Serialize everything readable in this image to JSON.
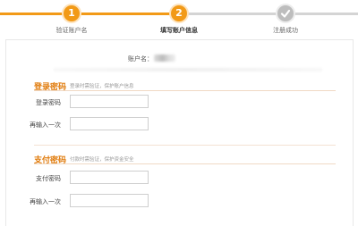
{
  "stepper": {
    "steps": [
      {
        "number": "1",
        "label": "验证账户名"
      },
      {
        "number": "2",
        "label": "填写账户信息"
      },
      {
        "number": "",
        "label": "注册成功"
      }
    ],
    "active_index": 1
  },
  "colors": {
    "accent": "#f29a17",
    "step_done": "#f29a17",
    "step_pending": "#bdbdbd",
    "section_title": "#e07a0a"
  },
  "account": {
    "label": "账户名：",
    "value_masked": ""
  },
  "login_password": {
    "title": "登录密码",
    "hint": "登录时需验证，保护账户信息",
    "fields": [
      {
        "label": "登录密码",
        "value": "",
        "placeholder": ""
      },
      {
        "label": "再输入一次",
        "value": "",
        "placeholder": ""
      }
    ]
  },
  "pay_password": {
    "title": "支付密码",
    "hint": "付款时需验证，保护资金安全",
    "fields": [
      {
        "label": "支付密码",
        "value": "",
        "placeholder": ""
      },
      {
        "label": "再输入一次",
        "value": "",
        "placeholder": ""
      }
    ]
  },
  "icons": {
    "step3": "check-icon"
  }
}
